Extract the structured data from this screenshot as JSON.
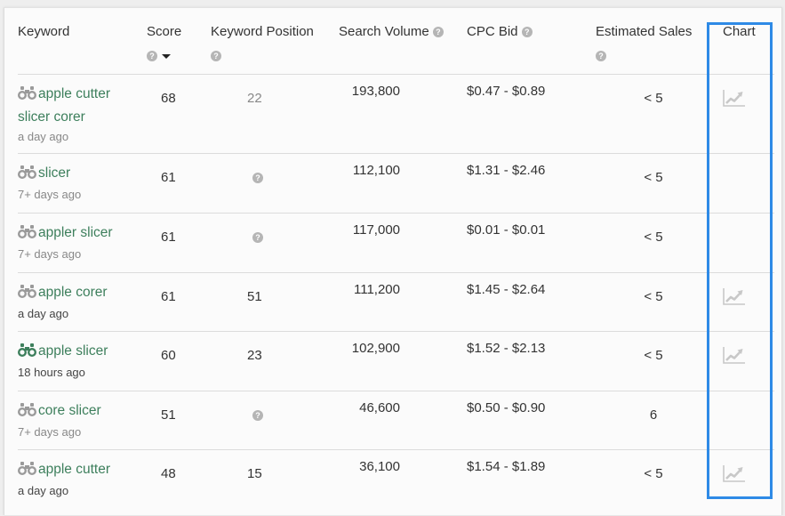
{
  "table": {
    "columns": [
      {
        "label": "Keyword",
        "help": false
      },
      {
        "label": "Score",
        "help": true,
        "sorted": "desc"
      },
      {
        "label": "Keyword Position",
        "help": true
      },
      {
        "label": "Search Volume",
        "help": true
      },
      {
        "label": "CPC Bid",
        "help": true
      },
      {
        "label": "Estimated Sales",
        "help": true
      },
      {
        "label": "Chart",
        "help": false
      }
    ],
    "help_glyph": "?",
    "rows": [
      {
        "keyword": "apple cutter slicer corer",
        "updated": "a day ago",
        "binoculars_active": false,
        "score": "68",
        "position": "22",
        "position_unknown": false,
        "position_muted": true,
        "volume": "193,800",
        "cpc": "$0.47 - $0.89",
        "sales": "< 5",
        "chart": true
      },
      {
        "keyword": "slicer",
        "updated": "7+ days ago",
        "binoculars_active": false,
        "score": "61",
        "position": "",
        "position_unknown": true,
        "volume": "112,100",
        "cpc": "$1.31 - $2.46",
        "sales": "< 5",
        "chart": false
      },
      {
        "keyword": "appler slicer",
        "updated": "7+ days ago",
        "binoculars_active": false,
        "score": "61",
        "position": "",
        "position_unknown": true,
        "volume": "117,000",
        "cpc": "$0.01 - $0.01",
        "sales": "< 5",
        "chart": false
      },
      {
        "keyword": "apple corer",
        "updated": "a day ago",
        "binoculars_active": false,
        "score": "61",
        "position": "51",
        "position_unknown": false,
        "volume": "111,200",
        "cpc": "$1.45 - $2.64",
        "sales": "< 5",
        "chart": true
      },
      {
        "keyword": "apple slicer",
        "updated": "18 hours ago",
        "binoculars_active": true,
        "score": "60",
        "position": "23",
        "position_unknown": false,
        "volume": "102,900",
        "cpc": "$1.52 - $2.13",
        "sales": "< 5",
        "chart": true
      },
      {
        "keyword": "core slicer",
        "updated": "7+ days ago",
        "binoculars_active": false,
        "score": "51",
        "position": "",
        "position_unknown": true,
        "volume": "46,600",
        "cpc": "$0.50 - $0.90",
        "sales": "6",
        "chart": false
      },
      {
        "keyword": "apple cutter",
        "updated": "a day ago",
        "binoculars_active": false,
        "score": "48",
        "position": "15",
        "position_unknown": false,
        "volume": "36,100",
        "cpc": "$1.54 - $1.89",
        "sales": "< 5",
        "chart": true
      }
    ]
  },
  "colors": {
    "keyword_link": "#3d7f5c",
    "binoculars_inactive": "#9a9a9a",
    "binoculars_active": "#3d7f5c",
    "highlight_border": "#2e8ae6",
    "chart_icon": "#c8c8c8"
  }
}
